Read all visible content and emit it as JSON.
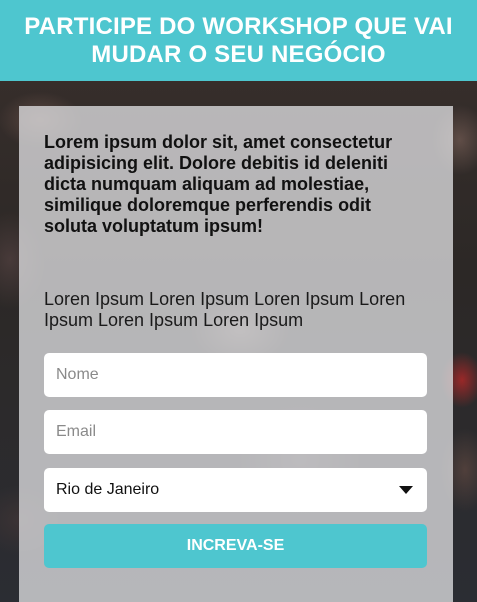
{
  "header": {
    "title": "PARTICIPE DO WORKSHOP QUE VAI MUDAR O SEU NEGÓCIO"
  },
  "card": {
    "intro": "Lorem ipsum dolor sit, amet consectetur adipisicing elit. Dolore debitis id deleniti dicta numquam aliquam ad molestiae, similique doloremque perferendis odit soluta voluptatum ipsum!",
    "subtext": "Loren Ipsum Loren Ipsum Loren Ipsum Loren Ipsum Loren Ipsum Loren Ipsum"
  },
  "form": {
    "name_placeholder": "Nome",
    "email_placeholder": "Email",
    "city_selected": "Rio de Janeiro",
    "submit_label": "INCREVA-SE"
  },
  "colors": {
    "accent": "#4ec6cf",
    "card_background": "#dedee0"
  }
}
